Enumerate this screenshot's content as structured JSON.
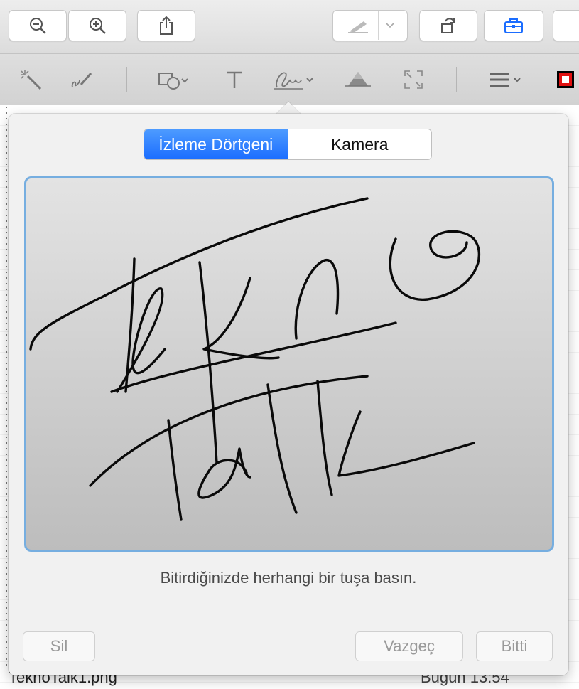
{
  "background_document": {
    "file_name": "TeknoTalk1.png",
    "date": "Bugün 13:54"
  },
  "toolbar": {
    "zoom_out_icon": "zoom-out-icon",
    "zoom_in_icon": "zoom-in-icon",
    "share_icon": "share-icon",
    "highlight_icon": "highlighter-icon",
    "rotate_icon": "rotate-icon",
    "markup_icon": "toolbox-icon"
  },
  "markup_toolbar": {
    "tools": [
      "instant-alpha-icon",
      "sketch-icon",
      "shapes-icon",
      "text-icon",
      "signature-icon",
      "adjust-color-icon",
      "adjust-size-icon",
      "line-style-icon",
      "border-color-icon"
    ],
    "border_color": "#e01010"
  },
  "signature_panel": {
    "segments": [
      "İzleme Dörtgeni",
      "Kamera"
    ],
    "selected_segment": "İzleme Dörtgeni",
    "instruction": "Bitirdiğinizde herhangi bir tuşa basın.",
    "clear_label": "Sil",
    "cancel_label": "Vazgeç",
    "done_label": "Bitti",
    "accent_color": "#1b6dff",
    "pad_border_color": "#76aee0"
  }
}
